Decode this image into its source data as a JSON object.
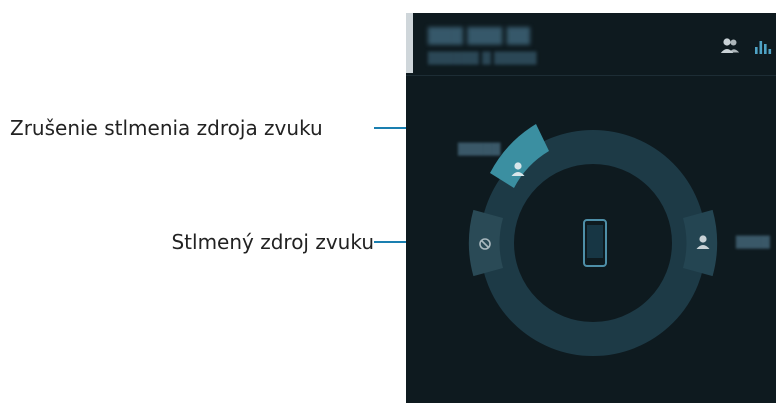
{
  "callouts": {
    "unmute_label": "Zrušenie stlmenia zdroja zvuku",
    "muted_label": "Stlmený zdroj zvuku"
  },
  "colors": {
    "screen_bg": "#0e1a1f",
    "ring": "#1d3a46",
    "ring_active_segment": "#3b8fa1",
    "ring_segment": "#2a4a56",
    "leader_line": "#1a7fb0",
    "icon": "#c9d2d6"
  },
  "icons": {
    "header_left": "group-icon",
    "header_right": "equalizer-icon",
    "center": "phone-device-icon",
    "top_source": "person-icon",
    "right_source": "person-icon",
    "left_source": "muted-icon"
  }
}
